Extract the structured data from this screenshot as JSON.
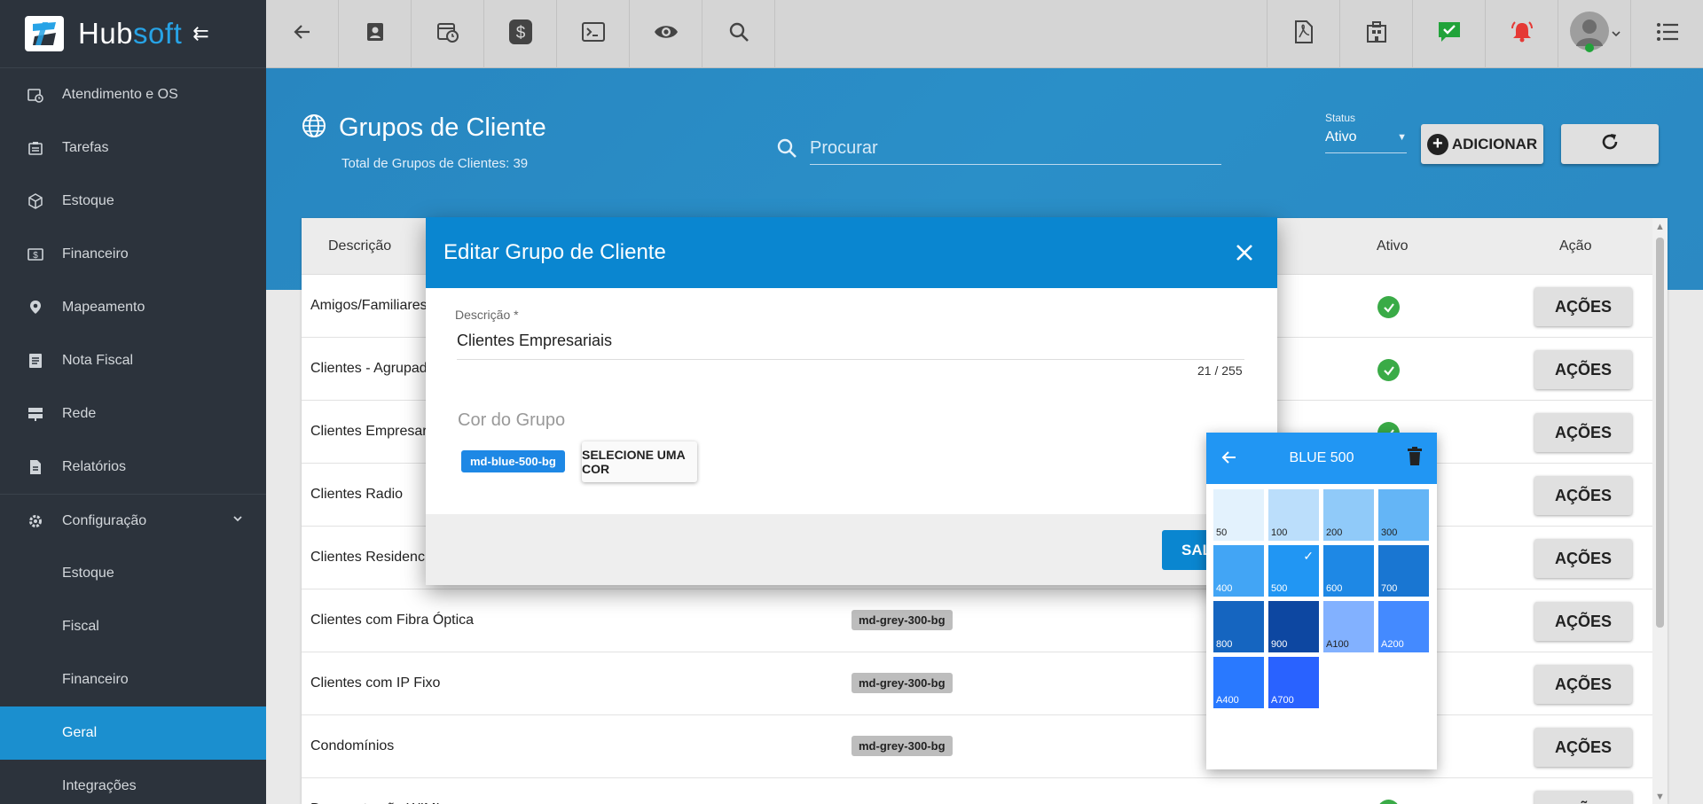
{
  "app": {
    "logo_hub": "Hub",
    "logo_soft": "soft",
    "brand_color": "#27a3e6"
  },
  "sidebar": {
    "items": [
      {
        "label": "Atendimento e OS",
        "icon": "calendar-clock-icon"
      },
      {
        "label": "Tarefas",
        "icon": "tasks-icon"
      },
      {
        "label": "Estoque",
        "icon": "box-icon"
      },
      {
        "label": "Financeiro",
        "icon": "money-icon"
      },
      {
        "label": "Mapeamento",
        "icon": "map-pin-icon"
      },
      {
        "label": "Nota Fiscal",
        "icon": "invoice-icon"
      },
      {
        "label": "Rede",
        "icon": "server-icon"
      },
      {
        "label": "Relatórios",
        "icon": "report-icon"
      },
      {
        "label": "Configuração",
        "icon": "gear-icon"
      }
    ],
    "subitems": [
      {
        "label": "Estoque"
      },
      {
        "label": "Fiscal"
      },
      {
        "label": "Financeiro"
      },
      {
        "label": "Geral"
      },
      {
        "label": "Integrações"
      }
    ]
  },
  "page": {
    "title": "Grupos de Cliente",
    "subtitle": "Total de Grupos de Clientes: 39",
    "search_placeholder": "Procurar",
    "status_label": "Status",
    "status_value": "Ativo",
    "add_label": "ADICIONAR"
  },
  "table": {
    "headers": {
      "descricao": "Descrição",
      "ativo": "Ativo",
      "acao": "Ação"
    },
    "rows": [
      {
        "desc": "Amigos/Familiares",
        "chip": "",
        "ativo": true,
        "acao": "AÇÕES"
      },
      {
        "desc": "Clientes - Agrupad",
        "chip": "",
        "ativo": true,
        "acao": "AÇÕES"
      },
      {
        "desc": "Clientes Empresar",
        "chip": "",
        "ativo": true,
        "acao": "AÇÕES"
      },
      {
        "desc": "Clientes Radio",
        "chip": "",
        "ativo": false,
        "acao": "AÇÕES"
      },
      {
        "desc": "Clientes Residenci",
        "chip": "",
        "ativo": false,
        "acao": "AÇÕES"
      },
      {
        "desc": "Clientes com Fibra Óptica",
        "chip": "md-grey-300-bg",
        "ativo": false,
        "acao": "AÇÕES"
      },
      {
        "desc": "Clientes com IP Fixo",
        "chip": "md-grey-300-bg",
        "ativo": false,
        "acao": "AÇÕES"
      },
      {
        "desc": "Condomínios",
        "chip": "md-grey-300-bg",
        "ativo": false,
        "acao": "AÇÕES"
      },
      {
        "desc": "Demonstração WIMI",
        "chip": "",
        "ativo": true,
        "acao": "AÇÕES"
      }
    ]
  },
  "modal": {
    "title": "Editar Grupo de Cliente",
    "field_label": "Descrição *",
    "field_value": "Clientes Empresariais",
    "counter": "21 / 255",
    "cor_label": "Cor do Grupo",
    "cor_chip": "md-blue-500-bg",
    "select_label": "SELECIONE UMA COR",
    "save_label": "SALVAR"
  },
  "picker": {
    "title": "BLUE 500",
    "swatches": [
      {
        "name": "50",
        "color": "#e3f2fd",
        "text": "#222"
      },
      {
        "name": "100",
        "color": "#bbdefb",
        "text": "#222"
      },
      {
        "name": "200",
        "color": "#90caf9",
        "text": "#222"
      },
      {
        "name": "300",
        "color": "#64b5f6",
        "text": "#222"
      },
      {
        "name": "400",
        "color": "#42a5f5",
        "text": "#fff"
      },
      {
        "name": "500",
        "color": "#2196f3",
        "text": "#fff",
        "selected": true
      },
      {
        "name": "600",
        "color": "#1e88e5",
        "text": "#fff"
      },
      {
        "name": "700",
        "color": "#1976d2",
        "text": "#fff"
      },
      {
        "name": "800",
        "color": "#1565c0",
        "text": "#fff"
      },
      {
        "name": "900",
        "color": "#0d47a1",
        "text": "#fff"
      },
      {
        "name": "A100",
        "color": "#82b1ff",
        "text": "#222"
      },
      {
        "name": "A200",
        "color": "#448aff",
        "text": "#fff"
      },
      {
        "name": "A400",
        "color": "#2979ff",
        "text": "#fff"
      },
      {
        "name": "A700",
        "color": "#2962ff",
        "text": "#fff"
      }
    ]
  }
}
